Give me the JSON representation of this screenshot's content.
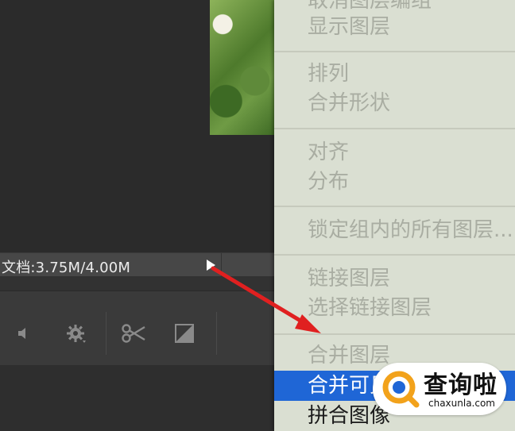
{
  "statusbar": {
    "doc_info": "文档:3.75M/4.00M"
  },
  "context_menu": {
    "items": [
      {
        "label": "取消图层编组",
        "enabled": false
      },
      {
        "label": "显示图层",
        "enabled": false
      },
      {
        "label": "排列",
        "enabled": false
      },
      {
        "label": "合并形状",
        "enabled": false
      },
      {
        "label": "对齐",
        "enabled": false
      },
      {
        "label": "分布",
        "enabled": false
      },
      {
        "label": "锁定组内的所有图层...",
        "enabled": false
      },
      {
        "label": "链接图层",
        "enabled": false
      },
      {
        "label": "选择链接图层",
        "enabled": false
      },
      {
        "label": "合并图层",
        "enabled": false
      },
      {
        "label": "合并可见图层",
        "enabled": true,
        "highlighted": true
      },
      {
        "label": "拼合图像",
        "enabled": true
      }
    ]
  },
  "icons": {
    "status_arrow": "triangle-right-icon",
    "toolbar": [
      "speaker-icon",
      "gear-icon",
      "scissors-icon",
      "transition-icon"
    ]
  },
  "watermark": {
    "title": "查询啦",
    "url": "chaxunla.com"
  },
  "colors": {
    "menu_bg": "#dadfd2",
    "menu_highlight": "#1f66d6",
    "annotation_arrow": "#e02020",
    "watermark_accent": "#f2a21b"
  }
}
